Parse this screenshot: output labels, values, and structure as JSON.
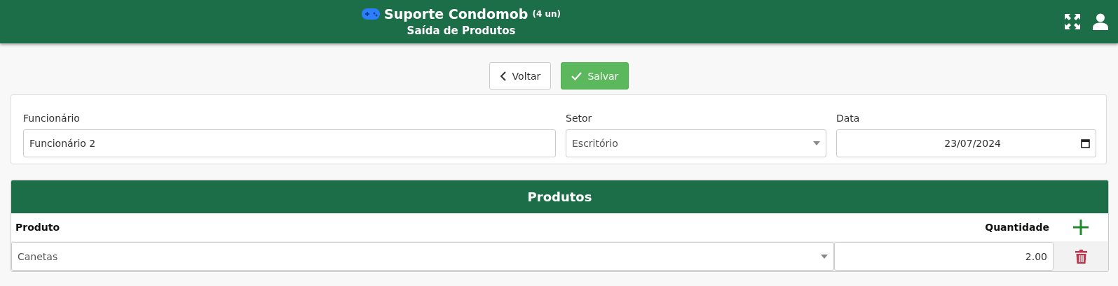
{
  "header": {
    "title": "Suporte Condomob",
    "count": "(4 un)",
    "subtitle": "Saída de Produtos"
  },
  "actions": [
    {
      "kind": "back",
      "label": "Voltar"
    },
    {
      "kind": "save",
      "label": "Salvar"
    }
  ],
  "fields": [
    {
      "kind": "text",
      "label": "Funcionário",
      "value": "Funcionário 2"
    },
    {
      "kind": "select",
      "label": "Setor",
      "value": "Escritório"
    },
    {
      "kind": "date",
      "label": "Data",
      "value": "23/07/2024"
    }
  ],
  "products": {
    "title": "Produtos",
    "columns": [
      "Produto",
      "Quantidade"
    ],
    "rows": [
      {
        "product": "Canetas",
        "quantity": "2.00"
      }
    ]
  }
}
